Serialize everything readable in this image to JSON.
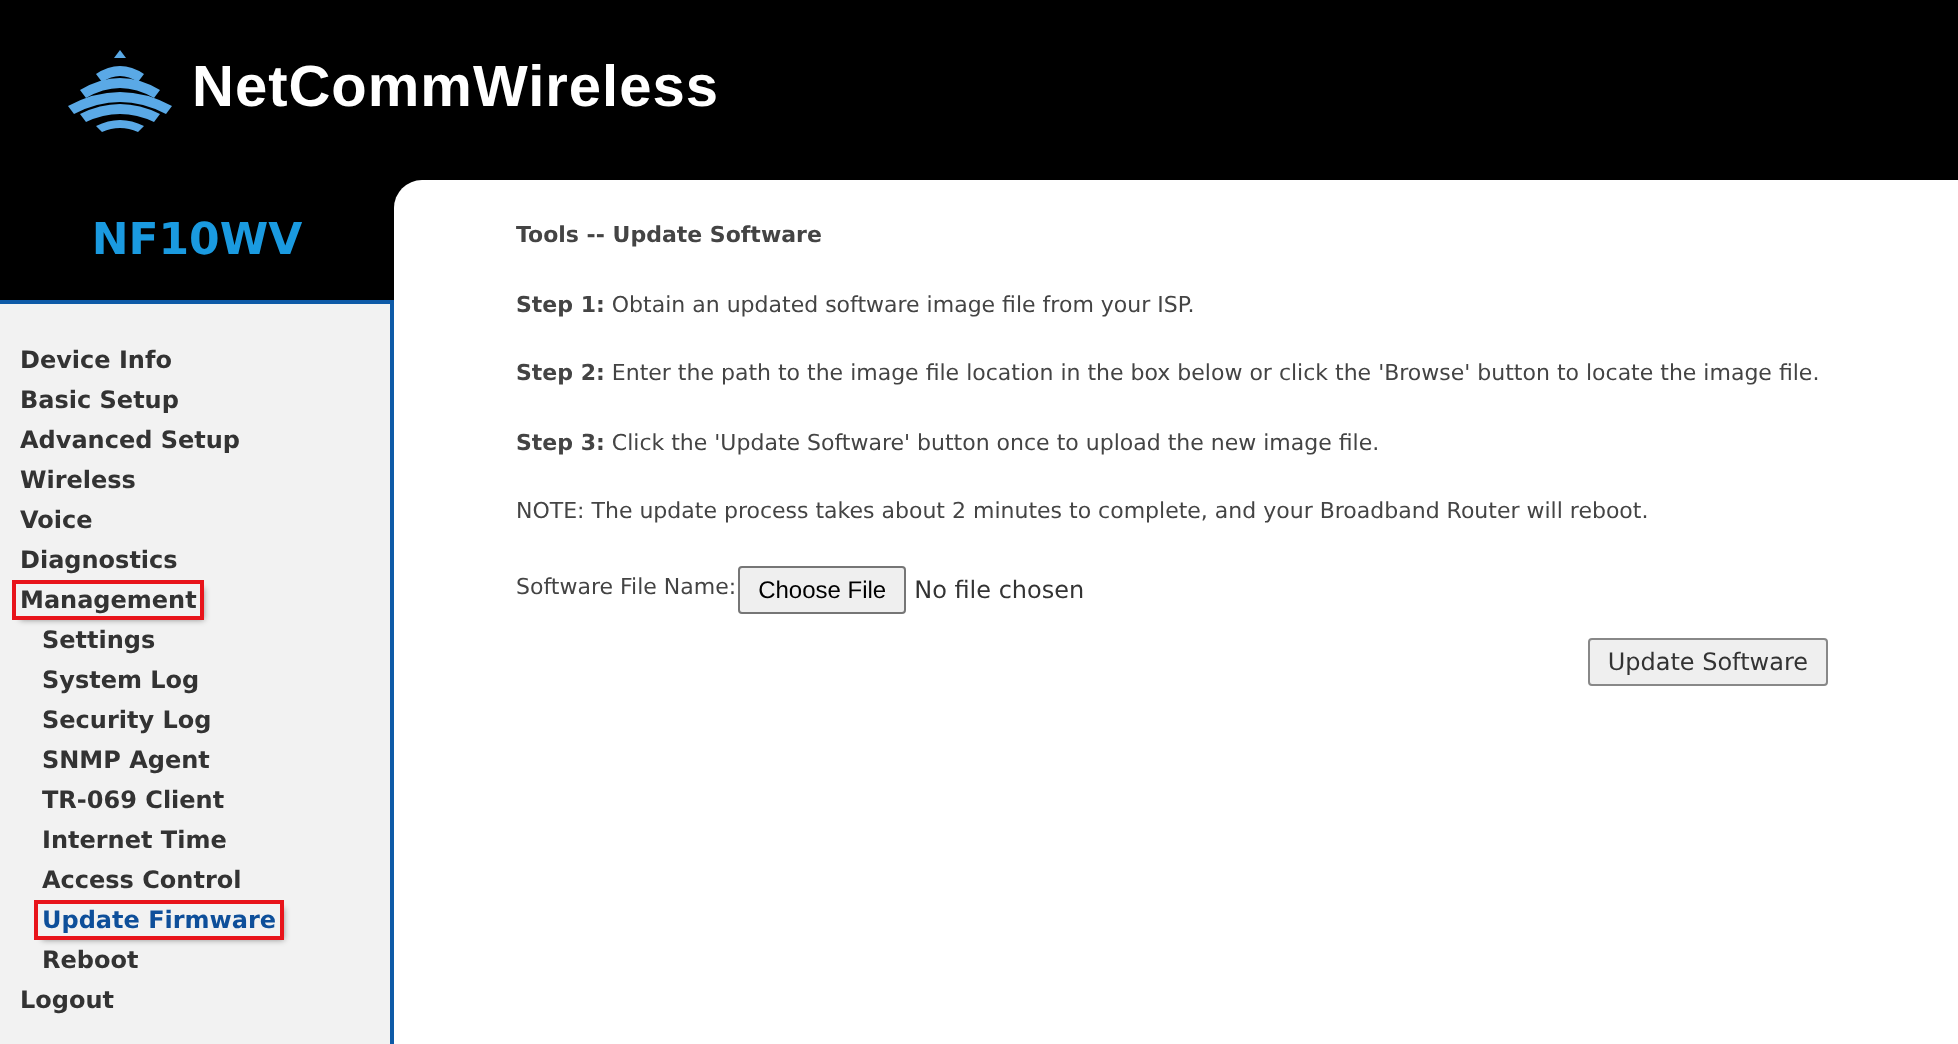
{
  "header": {
    "logo": "NetCommWireless"
  },
  "model": "NF10WV",
  "sidebar": {
    "items": [
      {
        "label": "Device Info",
        "selected": false,
        "highlighted": false
      },
      {
        "label": "Basic Setup",
        "selected": false,
        "highlighted": false
      },
      {
        "label": "Advanced Setup",
        "selected": false,
        "highlighted": false
      },
      {
        "label": "Wireless",
        "selected": false,
        "highlighted": false
      },
      {
        "label": "Voice",
        "selected": false,
        "highlighted": false
      },
      {
        "label": "Diagnostics",
        "selected": false,
        "highlighted": false
      },
      {
        "label": "Management",
        "selected": false,
        "highlighted": true,
        "children": [
          {
            "label": "Settings",
            "selected": false,
            "highlighted": false
          },
          {
            "label": "System Log",
            "selected": false,
            "highlighted": false
          },
          {
            "label": "Security Log",
            "selected": false,
            "highlighted": false
          },
          {
            "label": "SNMP Agent",
            "selected": false,
            "highlighted": false
          },
          {
            "label": "TR-069 Client",
            "selected": false,
            "highlighted": false
          },
          {
            "label": "Internet Time",
            "selected": false,
            "highlighted": false
          },
          {
            "label": "Access Control",
            "selected": false,
            "highlighted": false
          },
          {
            "label": "Update Firmware",
            "selected": true,
            "highlighted": true
          },
          {
            "label": "Reboot",
            "selected": false,
            "highlighted": false
          }
        ]
      },
      {
        "label": "Logout",
        "selected": false,
        "highlighted": false
      }
    ]
  },
  "content": {
    "title": "Tools -- Update Software",
    "paragraphs": [
      "**Step 1:** Obtain an updated software image file from your ISP.",
      "**Step 2:** Enter the path to the image file location in the box below or click the 'Browse' button to locate the image file.",
      "**Step 3:** Click the 'Update Software' button once to upload the new image file.",
      "NOTE: The update process takes about 2 minutes to complete, and your Broadband Router will reboot."
    ],
    "file_field": {
      "label": "Software File Name:",
      "button": "Choose File",
      "value": "No file chosen"
    },
    "submit_button": "Update Software"
  }
}
